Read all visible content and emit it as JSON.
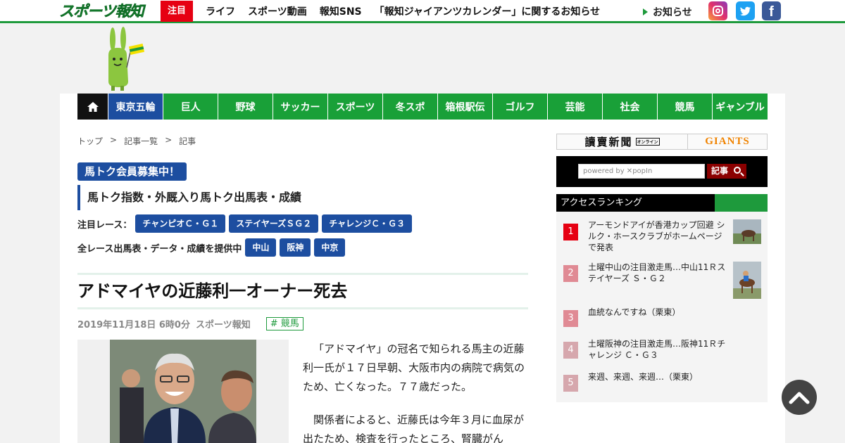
{
  "header": {
    "logo": "スポーツ報知",
    "hot_label": "注目",
    "nav": [
      "ライフ",
      "スポーツ動画",
      "報知SNS",
      "「報知ジャイアンツカレンダー」に関するお知らせ"
    ],
    "notice": "お知らせ",
    "sns": {
      "facebook_glyph": "f"
    }
  },
  "category_nav": [
    "東京五輪",
    "巨人",
    "野球",
    "サッカー",
    "スポーツ",
    "冬スポ",
    "箱根駅伝",
    "ゴルフ",
    "芸能",
    "社会",
    "競馬",
    "ギャンブル"
  ],
  "breadcrumb": [
    "トップ",
    ">",
    "記事一覧",
    ">",
    "記事"
  ],
  "promo": {
    "badge": "馬トク会員募集中！",
    "subtitle": "馬トク指数・外厩入り馬トク出馬表・成績",
    "featured_label": "注目レース：",
    "featured_races": [
      "チャンピオＣ・Ｇ１",
      "ステイヤーズＳＧ２",
      "チャレンジＣ・Ｇ３"
    ],
    "all_label": "全レース出馬表・データ・成績を提供中",
    "tracks": [
      "中山",
      "阪神",
      "中京"
    ]
  },
  "article": {
    "title": "アドマイヤの近藤利一オーナー死去",
    "date": "2019年11月18日 6時0分",
    "source": "スポーツ報知",
    "tag": "# 競馬",
    "paragraphs": [
      "「アドマイヤ」の冠名で知られる馬主の近藤利一氏が１７日早朝、大阪市内の病院で病気のため、亡くなった。７７歳だった。",
      "関係者によると、近藤氏は今年３月に血尿が出たため、検査を行ったところ、腎臓がん"
    ]
  },
  "sidebar": {
    "yomiuri_label": "讀賣新聞",
    "yomiuri_sub": "オンライン",
    "giants_label": "GIANTS",
    "search_placeholder": "powered by ✕popIn",
    "search_button": "記事",
    "ranking_title": "アクセスランキング",
    "ranking": [
      {
        "rank": "1",
        "title": "アーモンドアイが香港カップ回避 シルク・ホースクラブがホームページで発表",
        "color": "#e60012"
      },
      {
        "rank": "2",
        "title": "土曜中山の注目激走馬…中山11Ｒステイヤーズ Ｓ・Ｇ２",
        "color": "#e08a94"
      },
      {
        "rank": "3",
        "title": "血統なんですね（栗東）",
        "color": "#e08a94"
      },
      {
        "rank": "4",
        "title": "土曜阪神の注目激走馬…阪神11Ｒチャレンジ Ｃ・Ｇ３",
        "color": "#d6a7ad"
      },
      {
        "rank": "5",
        "title": "来週、来週、来週…（栗東）",
        "color": "#d6a7ad"
      }
    ]
  },
  "colors": {
    "brand_green": "#1e9a3c",
    "nav_blue": "#1d4ea0",
    "hot_red": "#e60012"
  }
}
